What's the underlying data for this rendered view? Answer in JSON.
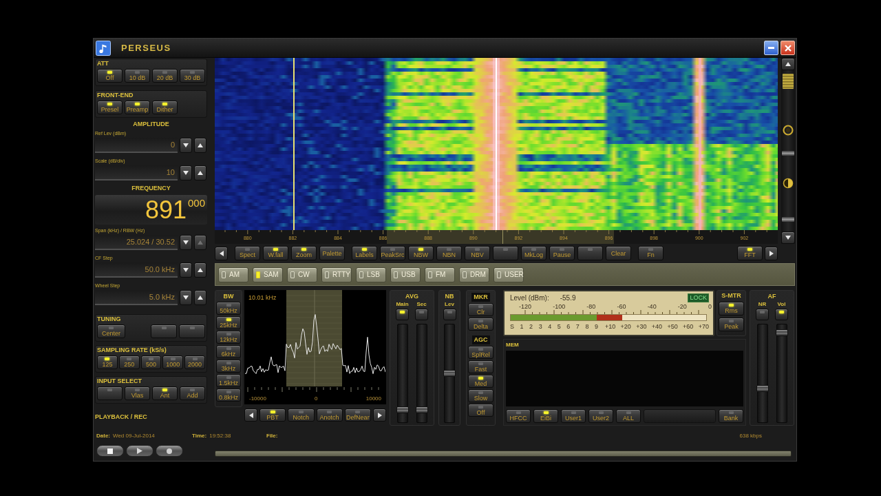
{
  "window": {
    "title": "PERSEUS"
  },
  "att": {
    "label": "ATT",
    "buttons": [
      {
        "label": "Off",
        "selected": true
      },
      {
        "label": "10 dB",
        "selected": false
      },
      {
        "label": "20 dB",
        "selected": false
      },
      {
        "label": "30 dB",
        "selected": false
      }
    ]
  },
  "front_end": {
    "label": "FRONT-END",
    "buttons": [
      {
        "label": "Presel",
        "on": true
      },
      {
        "label": "Preamp",
        "on": true
      },
      {
        "label": "Dither",
        "on": true
      }
    ]
  },
  "amplitude": {
    "label": "AMPLITUDE",
    "fields": [
      {
        "label": "Ref Lev (dBm)",
        "value": "0",
        "up_disabled": false
      },
      {
        "label": "Scale (dB/div)",
        "value": "10",
        "up_disabled": false
      }
    ]
  },
  "frequency": {
    "label": "FREQUENCY",
    "khz": "891",
    "hz": "000",
    "fields": [
      {
        "label": "Span (kHz) / RBW (Hz)",
        "value": "25.024 / 30.52",
        "up_disabled": true
      },
      {
        "label": "CF Step",
        "value": "50.0 kHz",
        "up_disabled": false
      },
      {
        "label": "Wheel Step",
        "value": "5.0 kHz",
        "up_disabled": false
      }
    ]
  },
  "tuning": {
    "label": "TUNING",
    "buttons": [
      {
        "label": "Center",
        "on": false
      },
      {
        "on": false
      },
      {
        "on": false
      }
    ]
  },
  "sampling_rate": {
    "label": "SAMPLING RATE (kS/s)",
    "buttons": [
      {
        "label": "125",
        "selected": true
      },
      {
        "label": "250",
        "selected": false
      },
      {
        "label": "500",
        "selected": false
      },
      {
        "label": "1000",
        "selected": false
      },
      {
        "label": "2000",
        "selected": false
      }
    ]
  },
  "input_select": {
    "label": "INPUT SELECT",
    "buttons": [
      {
        "selected": false
      },
      {
        "label": "Vlas",
        "selected": false
      },
      {
        "label": "Ant",
        "selected": true
      },
      {
        "label": "Add",
        "selected": false
      }
    ]
  },
  "spectrum": {
    "axis_labels": [
      "880",
      "882",
      "884",
      "886",
      "888",
      "890",
      "892",
      "894",
      "896",
      "898",
      "900",
      "902"
    ],
    "toolbar_groups": [
      [
        {
          "kind": "toggle",
          "label": "Spect",
          "on": false
        },
        {
          "kind": "toggle",
          "label": "W.fall",
          "on": true
        },
        {
          "kind": "toggle",
          "label": "Zoom",
          "on": true
        },
        {
          "kind": "action",
          "label": "Palette"
        }
      ],
      [
        {
          "kind": "toggle",
          "label": "Labels",
          "on": true
        },
        {
          "kind": "toggle",
          "label": "PeakSrc",
          "on": false
        },
        {
          "kind": "toggle",
          "label": "NBW",
          "on": true
        },
        {
          "kind": "toggle",
          "label": "NBN",
          "on": false
        },
        {
          "kind": "toggle",
          "label": "NBV",
          "on": false
        },
        {
          "kind": "toggle",
          "on": false
        },
        {
          "kind": "toggle",
          "label": "MkLog",
          "on": false
        },
        {
          "kind": "toggle",
          "label": "Pause",
          "on": false
        },
        {
          "kind": "toggle",
          "on": false
        },
        {
          "kind": "action",
          "label": "Clear"
        }
      ],
      [
        {
          "kind": "toggle",
          "label": "Fn",
          "on": false
        }
      ],
      [
        {
          "kind": "toggle",
          "label": "FFT",
          "on": true
        }
      ]
    ]
  },
  "modes": [
    {
      "label": "AM",
      "selected": false
    },
    {
      "label": "SAM",
      "selected": true
    },
    {
      "label": "CW",
      "selected": false
    },
    {
      "label": "RTTY",
      "selected": false
    },
    {
      "label": "LSB",
      "selected": false
    },
    {
      "label": "USB",
      "selected": false
    },
    {
      "label": "FM",
      "selected": false
    },
    {
      "label": "DRM",
      "selected": false
    },
    {
      "label": "USER",
      "selected": false
    }
  ],
  "bandwidth": {
    "label": "BW",
    "buttons": [
      {
        "label": "50kHz",
        "selected": false
      },
      {
        "label": "25kHz",
        "selected": true
      },
      {
        "label": "12kHz",
        "selected": false
      },
      {
        "label": "6kHz",
        "selected": false
      },
      {
        "label": "3kHz",
        "selected": false
      },
      {
        "label": "1.5kHz",
        "selected": false
      },
      {
        "label": "0.8kHz",
        "selected": false
      }
    ]
  },
  "filter": {
    "width": "10.01 kHz",
    "axis_labels": [
      "-10000",
      "0",
      "10000"
    ],
    "buttons": [
      {
        "label": "PBT",
        "on": true
      },
      {
        "label": "Notch",
        "on": false
      },
      {
        "label": "Anotch",
        "on": false
      },
      {
        "label": "DefNear",
        "on": false
      }
    ]
  },
  "avg": {
    "label": "AVG",
    "channels": [
      {
        "label": "Main",
        "on": true,
        "level": 0.1
      },
      {
        "label": "Sec",
        "on": false,
        "level": 0.1
      }
    ]
  },
  "nb": {
    "label": "NB",
    "channels": [
      {
        "label": "Lev",
        "on": false,
        "level": 0.5
      }
    ]
  },
  "marker": {
    "label": "MKR",
    "buttons": [
      {
        "label": "Clr",
        "on": false
      },
      {
        "label": "Delta",
        "on": false
      }
    ]
  },
  "agc": {
    "label": "AGC",
    "buttons": [
      {
        "label": "SplRel",
        "selected": false
      },
      {
        "label": "Fast",
        "selected": false
      },
      {
        "label": "Med",
        "selected": true
      },
      {
        "label": "Slow",
        "selected": false
      },
      {
        "label": "Off",
        "selected": false
      }
    ]
  },
  "meter": {
    "label": "Level (dBm):",
    "reading": "-55.9",
    "badge": "LOCK",
    "dbm_scale": [
      "-120",
      "-100",
      "-80",
      "-60",
      "-40",
      "-20",
      "0"
    ],
    "s_units": [
      "S",
      "1",
      "2",
      "3",
      "4",
      "5",
      "6",
      "7",
      "8",
      "9"
    ],
    "over_s9": [
      "+10",
      "+20",
      "+30",
      "+40",
      "+50",
      "+60",
      "+70"
    ],
    "level": 0.57
  },
  "s_meter": {
    "label": "S-MTR",
    "buttons": [
      {
        "label": "Rms",
        "selected": true
      },
      {
        "label": "Peak",
        "selected": false
      }
    ]
  },
  "memory": {
    "label": "MEM",
    "buttons": [
      {
        "label": "HFCC",
        "on": false
      },
      {
        "label": "EiBi",
        "on": true
      },
      {
        "label": "User1",
        "on": false
      },
      {
        "label": "User2",
        "on": false
      },
      {
        "label": "ALL",
        "on": false
      }
    ],
    "bank_button": {
      "label": "Bank",
      "on": false
    }
  },
  "af": {
    "label": "AF",
    "channels": [
      {
        "label": "NR",
        "on": false,
        "level": 0.33
      },
      {
        "label": "Vol",
        "on": true,
        "level": 0.95
      }
    ]
  },
  "playback": {
    "label": "PLAYBACK / REC",
    "date_label": "Date:",
    "date": "Wed 09-Jul-2014",
    "time_label": "Time:",
    "time": "19:52:38",
    "file_label": "File:",
    "rate": "638 kbps"
  }
}
